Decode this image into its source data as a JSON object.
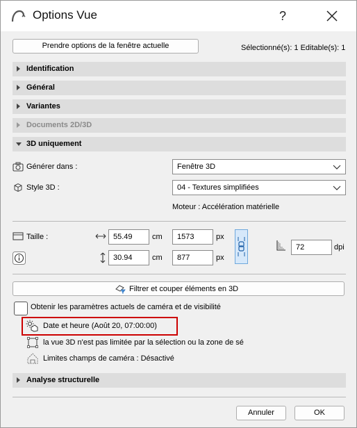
{
  "window": {
    "title": "Options Vue",
    "help": "?"
  },
  "toolbar": {
    "take_options_label": "Prendre options de la fenêtre actuelle",
    "selection_info": "Sélectionné(s): 1 Editable(s): 1"
  },
  "sections": [
    {
      "label": "Identification"
    },
    {
      "label": "Général"
    },
    {
      "label": "Variantes"
    },
    {
      "label": "Documents 2D/3D"
    },
    {
      "label": "3D uniquement"
    }
  ],
  "three_d": {
    "generate_label": "Générer dans :",
    "generate_value": "Fenêtre 3D",
    "style_label": "Style 3D :",
    "style_value": "04 - Textures simplifiées",
    "engine": "Moteur : Accélération matérielle"
  },
  "size": {
    "label": "Taille :",
    "width_cm": "55.49",
    "width_px": "1573",
    "height_cm": "30.94",
    "height_px": "877",
    "unit_cm": "cm",
    "unit_px": "px",
    "dpi_value": "72",
    "dpi_unit": "dpi"
  },
  "filter": {
    "label": "Filtrer et couper éléments en 3D"
  },
  "camera": {
    "checkbox_label": "Obtenir les paramètres actuels de caméra et de visibilité",
    "datetime": "Date et heure (Août 20, 07:00:00)",
    "selection_limit": "la vue 3D n'est pas limitée par la sélection ou la zone de sé",
    "camera_limits": "Limites champs de caméra : Désactivé"
  },
  "analysis": {
    "label": "Analyse structurelle"
  },
  "footer": {
    "cancel_label": "Annuler",
    "ok_label": "OK"
  }
}
